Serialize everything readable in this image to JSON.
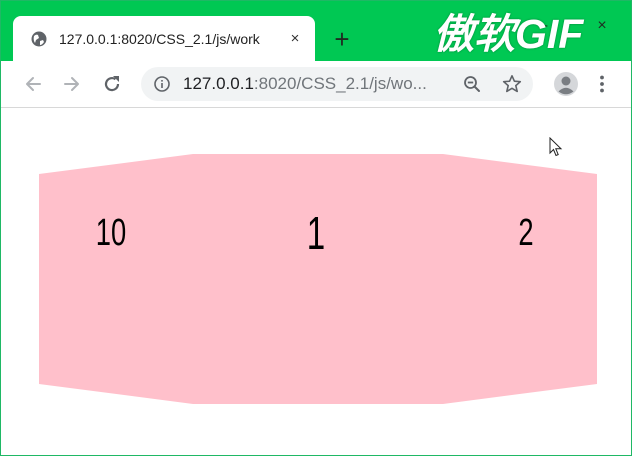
{
  "browser": {
    "tab_title": "127.0.0.1:8020/CSS_2.1/js/work",
    "tab_close": "×",
    "new_tab": "+",
    "minimize": "–",
    "close": "×",
    "url_host": "127.0.0.1",
    "url_path": ":8020/CSS_2.1/js/wo..."
  },
  "watermark": "傲软GIF",
  "carousel": {
    "left": "10",
    "center": "1",
    "right": "2"
  },
  "colors": {
    "titlebar": "#00c853",
    "shape": "#ffc0cb",
    "frame_border": "#1fb865"
  },
  "icons": [
    "globe-icon",
    "back-icon",
    "forward-icon",
    "reload-icon",
    "info-icon",
    "zoom-out-icon",
    "star-icon",
    "profile-icon",
    "menu-icon",
    "cursor-icon"
  ]
}
